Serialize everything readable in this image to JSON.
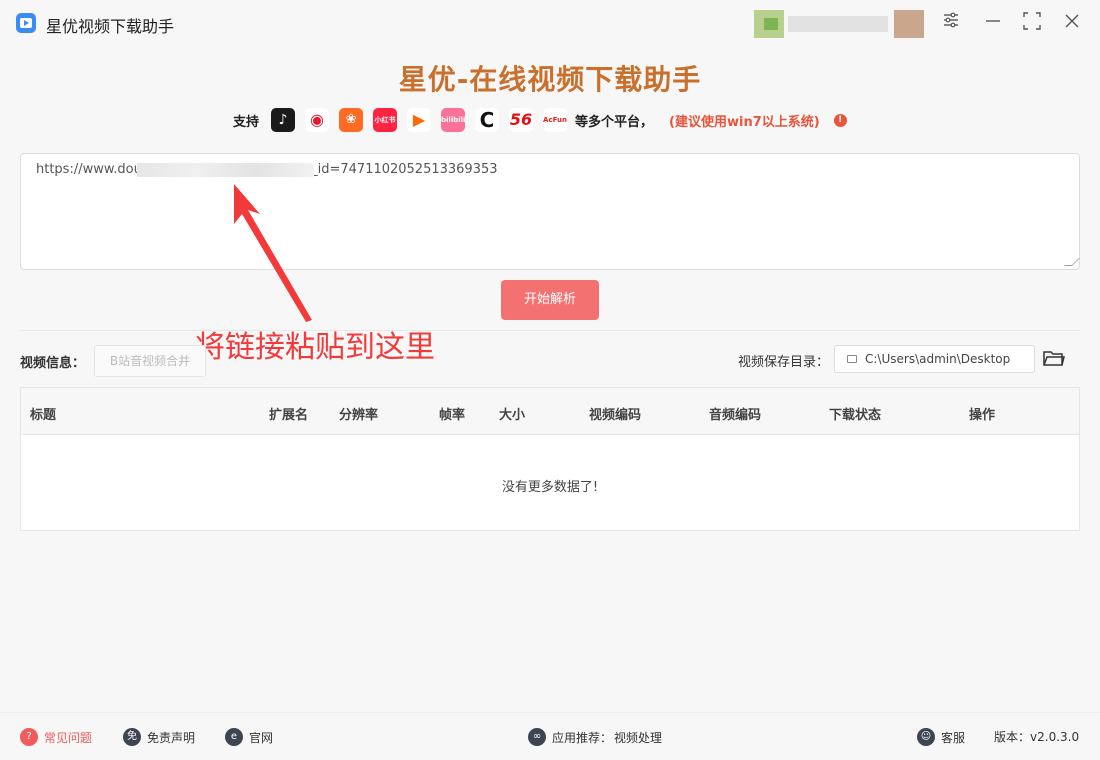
{
  "titlebar": {
    "app_title": "星优视频下载助手",
    "icons": [
      "settings-icon",
      "minimize-icon",
      "maximize-icon",
      "close-icon"
    ]
  },
  "header": {
    "brand": "星优-在线视频下载助手",
    "support_label": "支持",
    "platforms": [
      "抖音",
      "微博",
      "快手",
      "小红书",
      "腾讯视频",
      "bilibili",
      "CC",
      "56",
      "AcFun"
    ],
    "more": "等多个平台，",
    "system_note": "(建议使用win7以上系统)"
  },
  "url_input": {
    "value_prefix": "https://www.douj",
    "value_suffix": "l_id=7471102052513369353"
  },
  "parse_button": "开始解析",
  "annotation": "将链接粘贴到这里",
  "info_row": {
    "label": "视频信息：",
    "merge_button": "B站音视频合并",
    "save_label": "视频保存目录：",
    "save_path": "C:\\Users\\admin\\Desktop"
  },
  "table": {
    "columns": [
      "标题",
      "扩展名",
      "分辨率",
      "帧率",
      "大小",
      "视频编码",
      "音频编码",
      "下载状态",
      "操作"
    ],
    "empty_text": "没有更多数据了!"
  },
  "footer": {
    "faq": "常见问题",
    "disclaimer": "免责声明",
    "website": "官网",
    "recommend_label": "应用推荐：",
    "recommend_value": "视频处理",
    "support": "客服",
    "version_label": "版本：",
    "version": "v2.0.3.0"
  },
  "colors": {
    "brand": "#c9702c",
    "accent_red": "#f47172",
    "annotation_red": "#f33a3a",
    "note_red": "#e8553b"
  }
}
